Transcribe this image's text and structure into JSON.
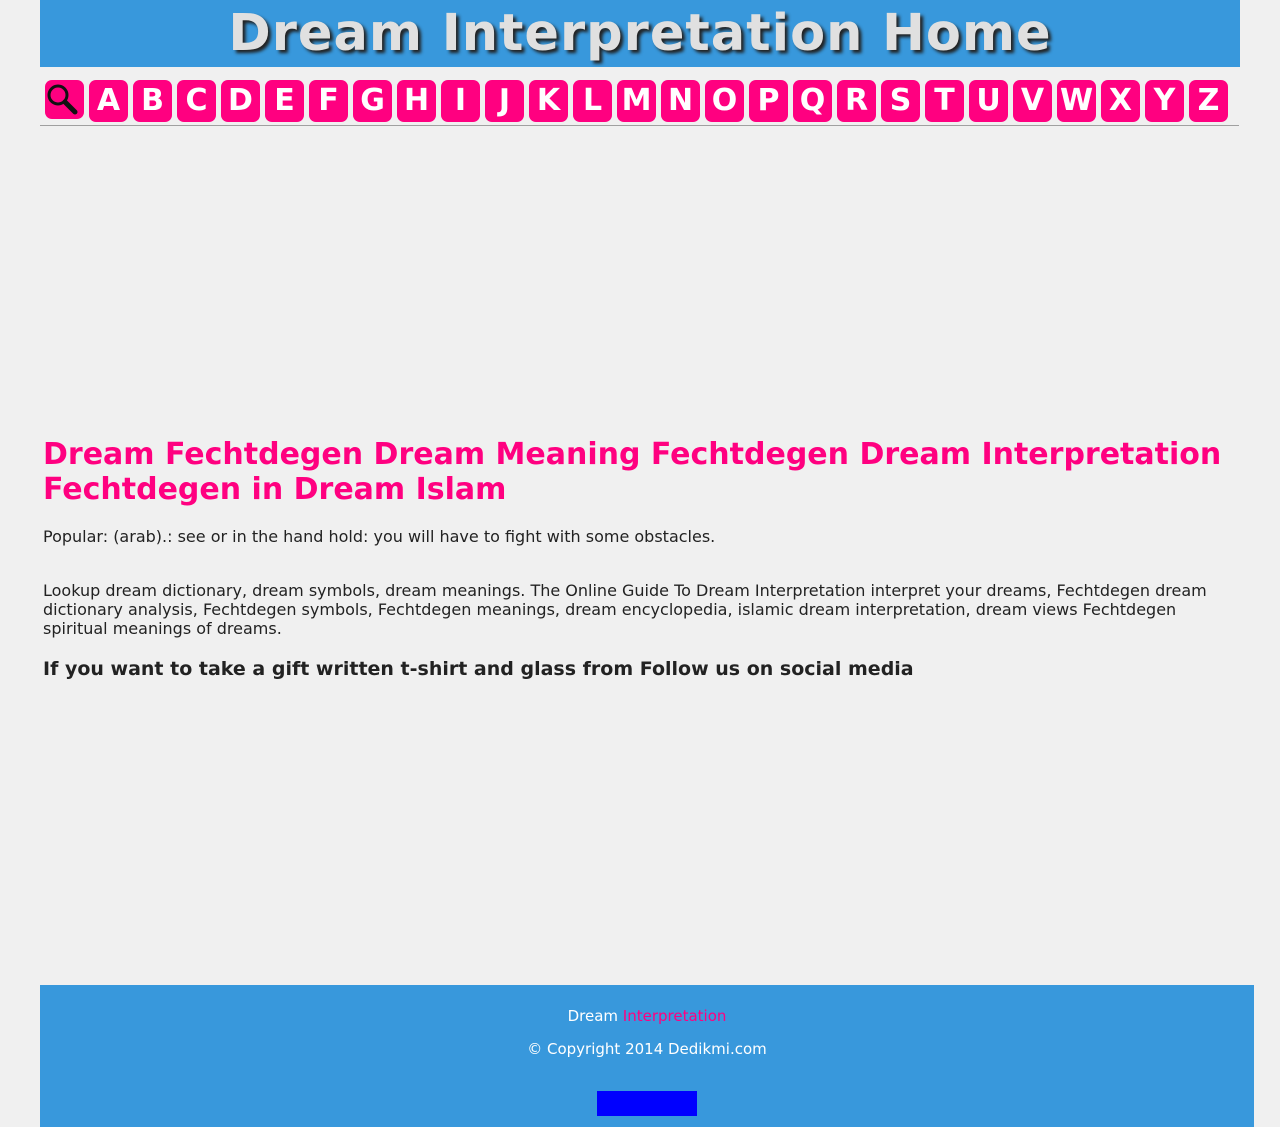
{
  "header": {
    "title": "Dream Interpretation Home"
  },
  "nav": {
    "search_icon": "magnifier-icon",
    "letters": [
      "A",
      "B",
      "C",
      "D",
      "E",
      "F",
      "G",
      "H",
      "I",
      "J",
      "K",
      "L",
      "M",
      "N",
      "O",
      "P",
      "Q",
      "R",
      "S",
      "T",
      "U",
      "V",
      "W",
      "X",
      "Y",
      "Z"
    ]
  },
  "main": {
    "title": "Dream Fechtdegen Dream Meaning Fechtdegen Dream Interpretation Fechtdegen in Dream Islam",
    "popular": "Popular: (arab).: see or in the hand hold: you will have to fight with some obstacles.",
    "lookup": "Lookup dream dictionary, dream symbols, dream meanings. The Online Guide To Dream Interpretation interpret your dreams, Fechtdegen dream dictionary analysis, Fechtdegen symbols, Fechtdegen meanings, dream encyclopedia, islamic dream interpretation, dream views Fechtdegen spiritual meanings of dreams.",
    "gift": "If you want to take a gift written t-shirt and glass from Follow us on social media"
  },
  "footer": {
    "brand_prefix": "Dream",
    "brand_link": "Interpretation",
    "copyright": "© Copyright 2014 Dedikmi.com"
  },
  "colors": {
    "header_bg": "#3898dc",
    "accent": "#ff0080",
    "page_bg": "#f0f0f0",
    "footer_block": "#0000ff"
  }
}
